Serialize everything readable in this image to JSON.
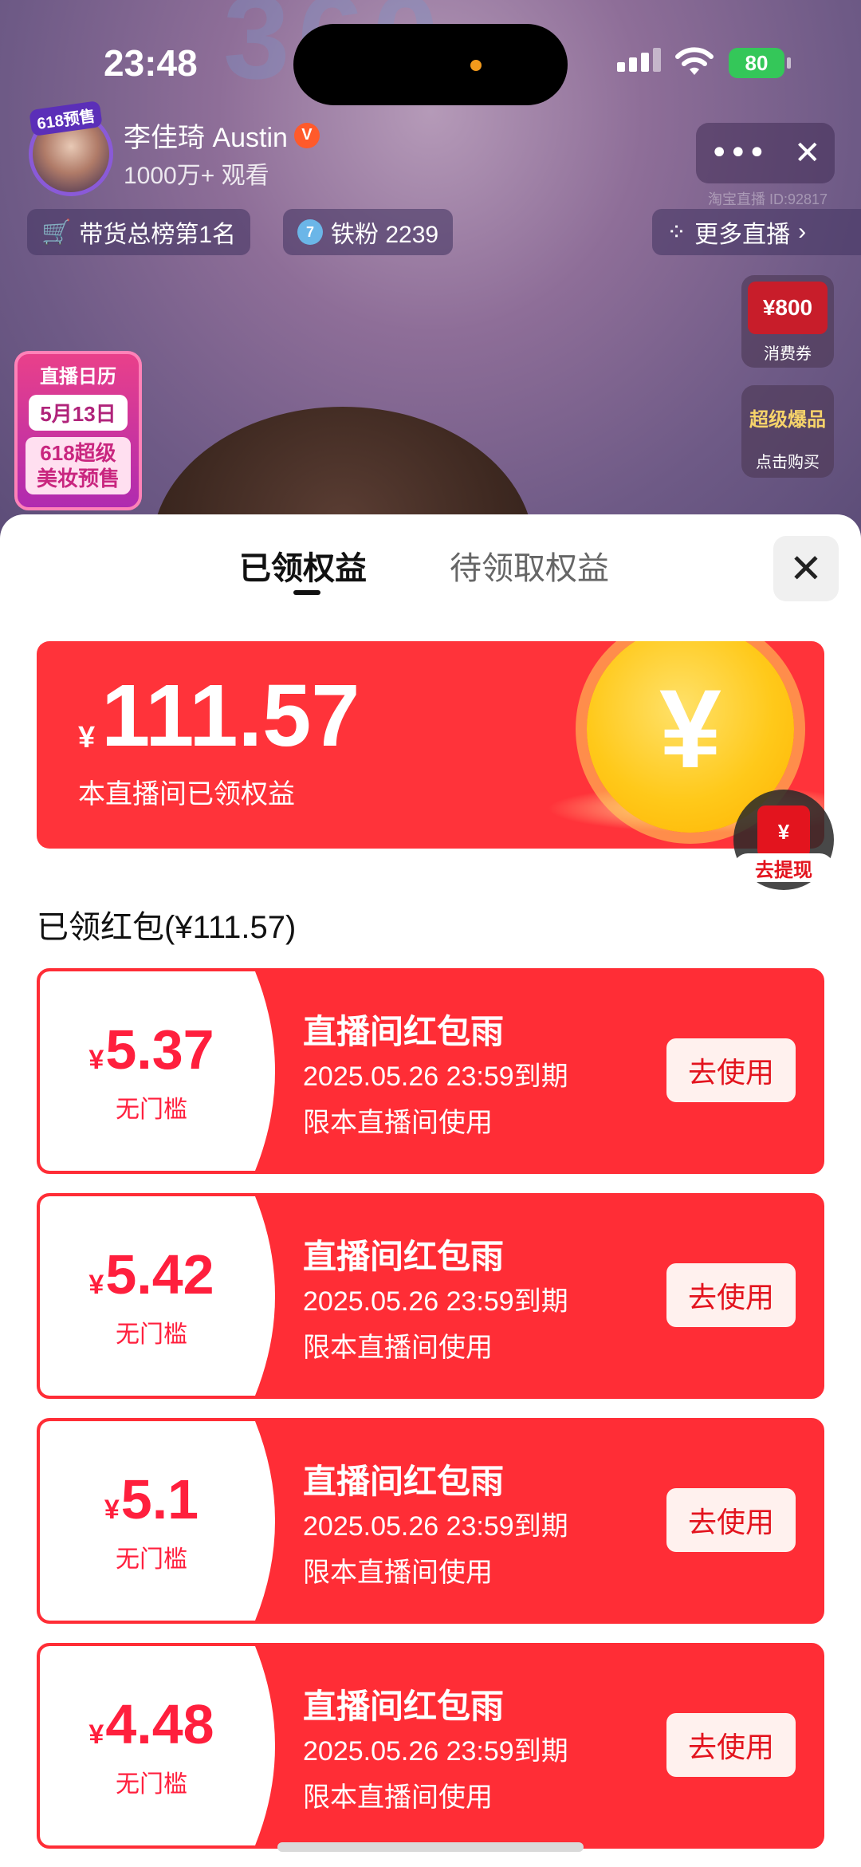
{
  "status": {
    "time": "23:48",
    "battery": "80"
  },
  "stream": {
    "avatar_tag": "618预售",
    "streamer_name": "李佳琦 Austin",
    "verified_mark": "V",
    "viewers": "1000万+ 观看",
    "room_id": "淘宝直播 ID:92817",
    "rank_label": "带货总榜第1名",
    "fans_level": "7",
    "fans_label": "铁粉 2239",
    "more_live": "更多直播",
    "calendar": {
      "title": "直播日历",
      "date": "5月13日",
      "line1": "618超级",
      "line2": "美妆预售"
    },
    "side_items": [
      {
        "img_text": "¥800",
        "label": "消费券"
      },
      {
        "img_text": "超级爆品",
        "label": "点击购买"
      }
    ]
  },
  "sheet": {
    "tabs": [
      {
        "label": "已领权益"
      },
      {
        "label": "待领取权益"
      }
    ],
    "banner": {
      "currency": "¥",
      "amount": "111.57",
      "label": "本直播间已领权益",
      "coin_symbol": "¥"
    },
    "withdraw": {
      "icon": "¥",
      "label": "去提现"
    },
    "section_title": "已领红包(¥111.57)",
    "coupons": [
      {
        "currency": "¥",
        "value": "5.37",
        "threshold": "无门槛",
        "title": "直播间红包雨",
        "expiry": "2025.05.26 23:59到期",
        "limit": "限本直播间使用",
        "button": "去使用"
      },
      {
        "currency": "¥",
        "value": "5.42",
        "threshold": "无门槛",
        "title": "直播间红包雨",
        "expiry": "2025.05.26 23:59到期",
        "limit": "限本直播间使用",
        "button": "去使用"
      },
      {
        "currency": "¥",
        "value": "5.1",
        "threshold": "无门槛",
        "title": "直播间红包雨",
        "expiry": "2025.05.26 23:59到期",
        "limit": "限本直播间使用",
        "button": "去使用"
      },
      {
        "currency": "¥",
        "value": "4.48",
        "threshold": "无门槛",
        "title": "直播间红包雨",
        "expiry": "2025.05.26 23:59到期",
        "limit": "限本直播间使用",
        "button": "去使用"
      }
    ]
  },
  "colors": {
    "accent_red": "#ff2d36",
    "coin_gold": "#ffc91a",
    "battery_green": "#34c759"
  }
}
